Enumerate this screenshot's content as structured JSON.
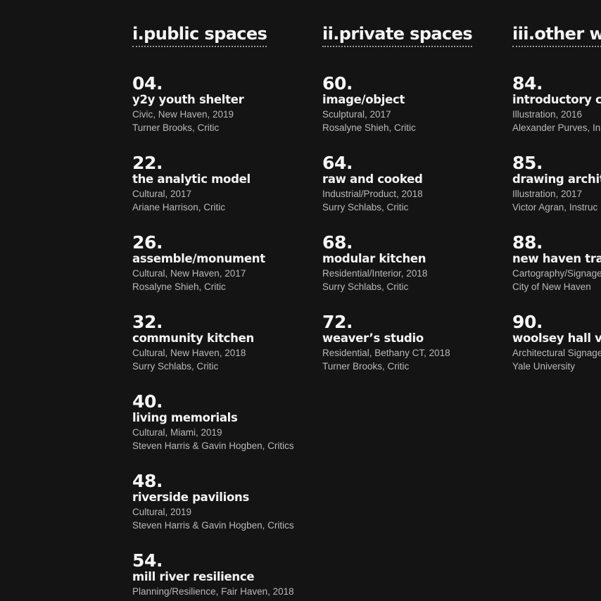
{
  "sections": [
    {
      "title": "i.public spaces",
      "entries": [
        {
          "num": "04.",
          "name": "y2y youth shelter",
          "meta": "Civic, New Haven, 2019",
          "credit": "Turner Brooks, Critic"
        },
        {
          "num": "22.",
          "name": "the analytic model",
          "meta": "Cultural, 2017",
          "credit": "Ariane Harrison, Critic"
        },
        {
          "num": "26.",
          "name": "assemble/monument",
          "meta": "Cultural, New Haven, 2017",
          "credit": "Rosalyne Shieh, Critic"
        },
        {
          "num": "32.",
          "name": "community kitchen",
          "meta": "Cultural, New Haven, 2018",
          "credit": "Surry Schlabs, Critic"
        },
        {
          "num": "40.",
          "name": "living memorials",
          "meta": "Cultural, Miami, 2019",
          "credit": "Steven Harris & Gavin Hogben, Critics"
        },
        {
          "num": "48.",
          "name": "riverside pavilions",
          "meta": "Cultural, 2019",
          "credit": "Steven Harris & Gavin Hogben, Critics"
        },
        {
          "num": "54.",
          "name": "mill river resilience",
          "meta": "Planning/Resilience, Fair Haven, 2018",
          "credit": ""
        }
      ]
    },
    {
      "title": "ii.private spaces",
      "entries": [
        {
          "num": "60.",
          "name": "image/object",
          "meta": "Sculptural, 2017",
          "credit": "Rosalyne Shieh, Critic"
        },
        {
          "num": "64.",
          "name": "raw and cooked",
          "meta": "Industrial/Product, 2018",
          "credit": "Surry Schlabs, Critic"
        },
        {
          "num": "68.",
          "name": "modular kitchen",
          "meta": "Residential/Interior, 2018",
          "credit": "Surry Schlabs, Critic"
        },
        {
          "num": "72.",
          "name": "weaver’s studio",
          "meta": "Residential, Bethany CT, 2018",
          "credit": "Turner Brooks, Critic"
        }
      ]
    },
    {
      "title": "iii.other w",
      "entries": [
        {
          "num": "84.",
          "name": "introductory co",
          "meta": "Illustration, 2016",
          "credit": "Alexander Purves, In"
        },
        {
          "num": "85.",
          "name": "drawing archit",
          "meta": "Illustration, 2017",
          "credit": "Victor Agran, Instruc"
        },
        {
          "num": "88.",
          "name": "new haven tran",
          "meta": "Cartography/Signage",
          "credit": "City of New Haven"
        },
        {
          "num": "90.",
          "name": "woolsey hall vi",
          "meta": "Architectural Signage",
          "credit": "Yale University"
        }
      ]
    }
  ]
}
